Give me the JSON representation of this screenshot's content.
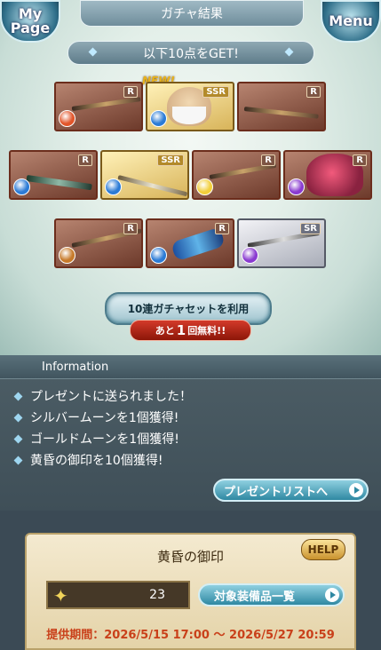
{
  "header": {
    "title": "ガチャ結果",
    "left_button": "My Page",
    "right_button": "Menu"
  },
  "result_banner": "以下10点をGET!",
  "new_badge": "NEW!",
  "cards": [
    {
      "rarity": "R",
      "element": "fire",
      "element_color": "#e2552a",
      "type": "weapon-rod"
    },
    {
      "rarity": "SSR",
      "element": "water",
      "element_color": "#2b7bd6",
      "type": "character"
    },
    {
      "rarity": "R",
      "element": "",
      "element_color": "",
      "type": "weapon-spear"
    },
    {
      "rarity": "R",
      "element": "water",
      "element_color": "#2b7bd6",
      "type": "weapon-sword"
    },
    {
      "rarity": "SSR",
      "element": "water",
      "element_color": "#2b7bd6",
      "type": "weapon-trident"
    },
    {
      "rarity": "R",
      "element": "light",
      "element_color": "#f2cf3a",
      "type": "weapon-dagger"
    },
    {
      "rarity": "R",
      "element": "dark",
      "element_color": "#8a3ad0",
      "type": "summon"
    },
    {
      "rarity": "R",
      "element": "earth",
      "element_color": "#c77a2a",
      "type": "weapon-spear"
    },
    {
      "rarity": "R",
      "element": "water",
      "element_color": "#2b7bd6",
      "type": "weapon-gauntlet"
    },
    {
      "rarity": "SR",
      "element": "dark",
      "element_color": "#8a3ad0",
      "type": "weapon-spear"
    }
  ],
  "gacha_set_button": "10連ガチャセットを利用",
  "free_remaining": {
    "prefix": "あと",
    "count": "1",
    "suffix": "回無料!!"
  },
  "information": {
    "title": "Information",
    "messages": [
      "プレゼントに送られました！",
      "シルバームーンを1個獲得!",
      "ゴールドムーンを1個獲得!",
      "黄昏の御印を10個獲得!"
    ],
    "present_list_button": "プレゼントリストへ"
  },
  "item_panel": {
    "title": "黄昏の御印",
    "help_button": "HELP",
    "count": "23",
    "list_button": "対象装備品一覧",
    "period": "提供期間：2026/5/15 17:00 〜 2026/5/27 20:59"
  }
}
